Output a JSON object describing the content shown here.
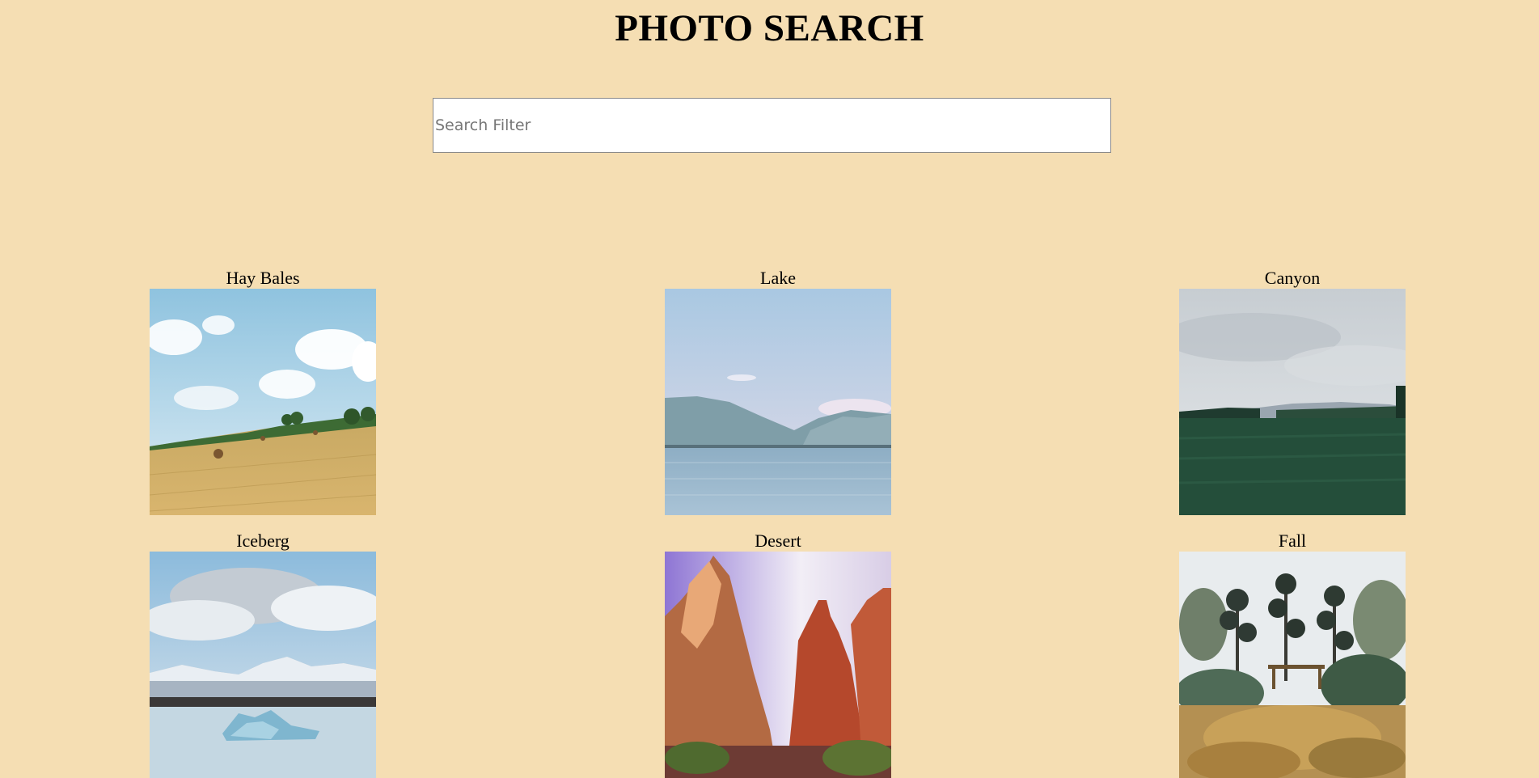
{
  "header": {
    "title": "PHOTO SEARCH"
  },
  "search": {
    "placeholder": "Search Filter",
    "value": ""
  },
  "photos": [
    {
      "label": "Hay Bales"
    },
    {
      "label": "Lake"
    },
    {
      "label": "Canyon"
    },
    {
      "label": "Iceberg"
    },
    {
      "label": "Desert"
    },
    {
      "label": "Fall"
    }
  ],
  "colors": {
    "background": "#f5deb3"
  }
}
